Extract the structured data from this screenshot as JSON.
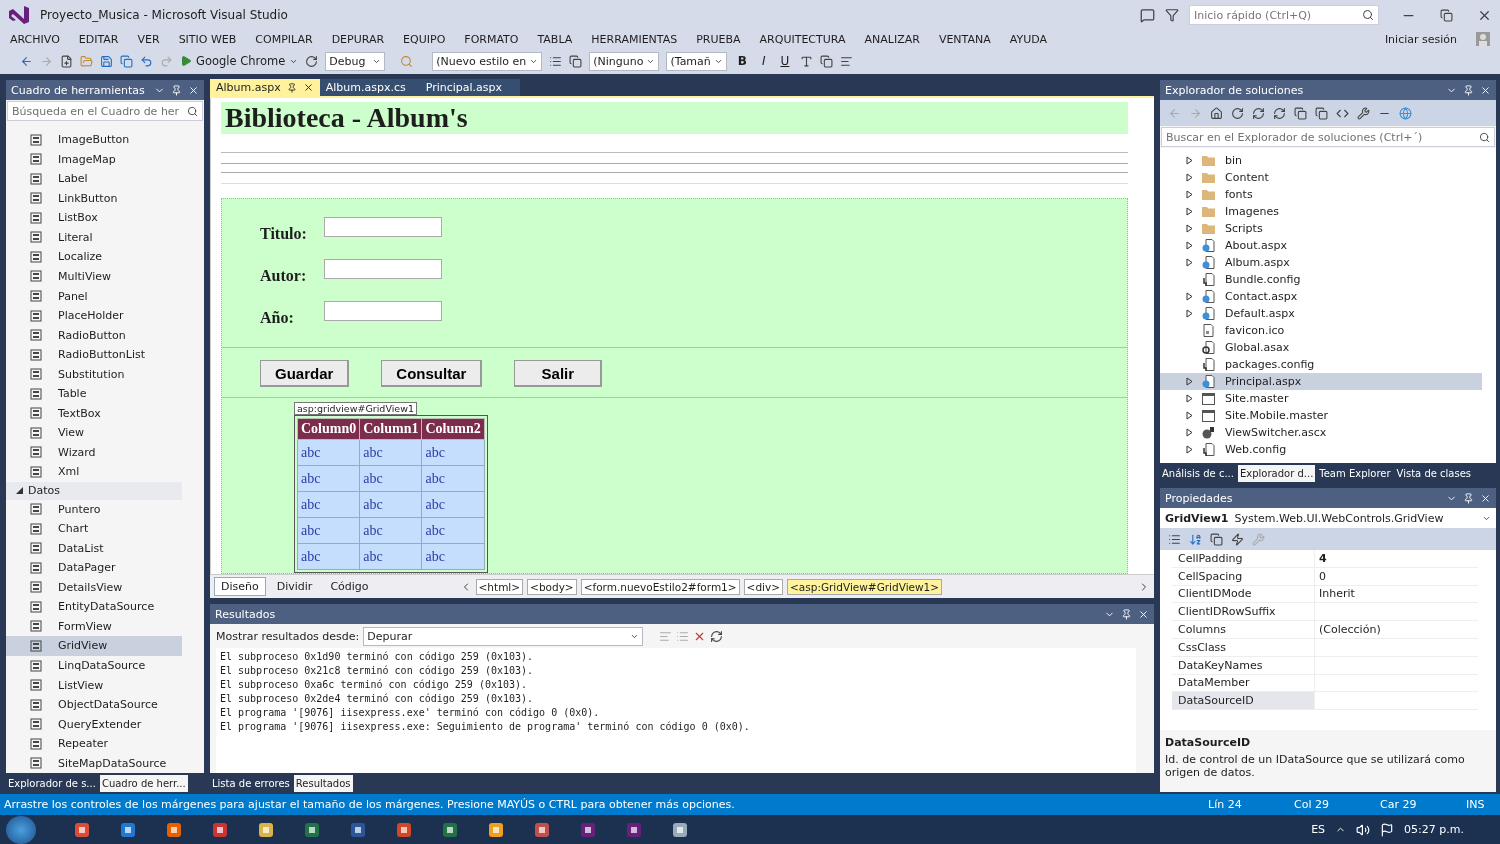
{
  "window": {
    "title": "Proyecto_Musica - Microsoft Visual Studio",
    "quick_launch_placeholder": "Inicio rápido (Ctrl+Q)",
    "sign_in": "Iniciar sesión"
  },
  "menu": [
    "ARCHIVO",
    "EDITAR",
    "VER",
    "SITIO WEB",
    "COMPILAR",
    "DEPURAR",
    "EQUIPO",
    "FORMATO",
    "TABLA",
    "HERRAMIENTAS",
    "PRUEBA",
    "ARQUITECTURA",
    "ANALIZAR",
    "VENTANA",
    "AYUDA"
  ],
  "toolbar": {
    "browser": "Google Chrome",
    "configuration": "Debug",
    "style": "(Nuevo estilo en",
    "font": "(Ninguno",
    "size": "(Tamañ",
    "bold": "B",
    "italic": "I",
    "underline": "U"
  },
  "toolbox": {
    "title": "Cuadro de herramientas",
    "search_placeholder": "Búsqueda en el Cuadro de her",
    "items": [
      {
        "label": "ImageButton",
        "selected": false
      },
      {
        "label": "ImageMap",
        "selected": false
      },
      {
        "label": "Label",
        "selected": false
      },
      {
        "label": "LinkButton",
        "selected": false
      },
      {
        "label": "ListBox",
        "selected": false
      },
      {
        "label": "Literal",
        "selected": false
      },
      {
        "label": "Localize",
        "selected": false
      },
      {
        "label": "MultiView",
        "selected": false
      },
      {
        "label": "Panel",
        "selected": false
      },
      {
        "label": "PlaceHolder",
        "selected": false
      },
      {
        "label": "RadioButton",
        "selected": false
      },
      {
        "label": "RadioButtonList",
        "selected": false
      },
      {
        "label": "Substitution",
        "selected": false
      },
      {
        "label": "Table",
        "selected": false
      },
      {
        "label": "TextBox",
        "selected": false
      },
      {
        "label": "View",
        "selected": false
      },
      {
        "label": "Wizard",
        "selected": false
      },
      {
        "label": "Xml",
        "selected": false
      }
    ],
    "group": {
      "label": "Datos",
      "expanded": true,
      "items": [
        {
          "label": "Puntero",
          "selected": false
        },
        {
          "label": "Chart",
          "selected": false
        },
        {
          "label": "DataList",
          "selected": false
        },
        {
          "label": "DataPager",
          "selected": false
        },
        {
          "label": "DetailsView",
          "selected": false
        },
        {
          "label": "EntityDataSource",
          "selected": false
        },
        {
          "label": "FormView",
          "selected": false
        },
        {
          "label": "GridView",
          "selected": true
        },
        {
          "label": "LinqDataSource",
          "selected": false
        },
        {
          "label": "ListView",
          "selected": false
        },
        {
          "label": "ObjectDataSource",
          "selected": false
        },
        {
          "label": "QueryExtender",
          "selected": false
        },
        {
          "label": "Repeater",
          "selected": false
        },
        {
          "label": "SiteMapDataSource",
          "selected": false
        }
      ]
    },
    "tabs": [
      {
        "label": "Explorador de s...",
        "selected": false
      },
      {
        "label": "Cuadro de herr...",
        "selected": true
      }
    ]
  },
  "editor": {
    "tabs": [
      {
        "label": "Album.aspx",
        "selected": true
      },
      {
        "label": "Album.aspx.cs",
        "selected": false
      },
      {
        "label": "Principal.aspx",
        "selected": false
      }
    ],
    "heading": "Biblioteca - Album's",
    "fields": [
      {
        "label": "Titulo:"
      },
      {
        "label": "Autor:"
      },
      {
        "label": "Año:"
      }
    ],
    "buttons": [
      "Guardar",
      "Consultar",
      "Salir"
    ],
    "grid": {
      "tag": "asp:gridview#GridView1",
      "columns": [
        "Column0",
        "Column1",
        "Column2"
      ],
      "rows": [
        [
          "abc",
          "abc",
          "abc"
        ],
        [
          "abc",
          "abc",
          "abc"
        ],
        [
          "abc",
          "abc",
          "abc"
        ],
        [
          "abc",
          "abc",
          "abc"
        ],
        [
          "abc",
          "abc",
          "abc"
        ]
      ]
    },
    "views": [
      {
        "label": "Diseño",
        "selected": true
      },
      {
        "label": "Dividir",
        "selected": false
      },
      {
        "label": "Código",
        "selected": false
      }
    ],
    "breadcrumbs": [
      {
        "label": "<html>",
        "selected": false
      },
      {
        "label": "<body>",
        "selected": false
      },
      {
        "label": "<form.nuevoEstilo2#form1>",
        "selected": false
      },
      {
        "label": "<div>",
        "selected": false
      },
      {
        "label": "<asp:GridView#GridView1>",
        "selected": true
      }
    ]
  },
  "output": {
    "title": "Resultados",
    "source_label": "Mostrar resultados desde:",
    "source": "Depurar",
    "lines": [
      "El subproceso 0x1d90 terminó con código 259 (0x103).",
      "El subproceso 0x21c8 terminó con código 259 (0x103).",
      "El subproceso 0xa6c terminó con código 259 (0x103).",
      "El subproceso 0x2de4 terminó con código 259 (0x103).",
      "El programa '[9076] iisexpress.exe' terminó con código 0 (0x0).",
      "El programa '[9076] iisexpress.exe: Seguimiento de programa' terminó con código 0 (0x0)."
    ],
    "tabs": [
      {
        "label": "Lista de errores",
        "selected": false
      },
      {
        "label": "Resultados",
        "selected": true
      }
    ]
  },
  "solution_explorer": {
    "title": "Explorador de soluciones",
    "search_placeholder": "Buscar en el Explorador de soluciones (Ctrl+´)",
    "items": [
      {
        "label": "bin",
        "kind": "folder",
        "expandable": true,
        "selected": false
      },
      {
        "label": "Content",
        "kind": "folder",
        "expandable": true,
        "selected": false
      },
      {
        "label": "fonts",
        "kind": "folder",
        "expandable": true,
        "selected": false
      },
      {
        "label": "Imagenes",
        "kind": "folder",
        "expandable": true,
        "selected": false
      },
      {
        "label": "Scripts",
        "kind": "folder",
        "expandable": true,
        "selected": false
      },
      {
        "label": "About.aspx",
        "kind": "page",
        "expandable": true,
        "selected": false
      },
      {
        "label": "Album.aspx",
        "kind": "page",
        "expandable": true,
        "selected": false
      },
      {
        "label": "Bundle.config",
        "kind": "config",
        "expandable": false,
        "selected": false
      },
      {
        "label": "Contact.aspx",
        "kind": "page",
        "expandable": true,
        "selected": false
      },
      {
        "label": "Default.aspx",
        "kind": "page",
        "expandable": true,
        "selected": false
      },
      {
        "label": "favicon.ico",
        "kind": "file",
        "expandable": false,
        "selected": false
      },
      {
        "label": "Global.asax",
        "kind": "global",
        "expandable": false,
        "selected": false
      },
      {
        "label": "packages.config",
        "kind": "config",
        "expandable": false,
        "selected": false
      },
      {
        "label": "Principal.aspx",
        "kind": "page",
        "expandable": true,
        "selected": true
      },
      {
        "label": "Site.master",
        "kind": "master",
        "expandable": true,
        "selected": false
      },
      {
        "label": "Site.Mobile.master",
        "kind": "master",
        "expandable": true,
        "selected": false
      },
      {
        "label": "ViewSwitcher.ascx",
        "kind": "control",
        "expandable": true,
        "selected": false
      },
      {
        "label": "Web.config",
        "kind": "config",
        "expandable": true,
        "selected": false
      }
    ],
    "tabs": [
      {
        "label": "Análisis de c...",
        "selected": false
      },
      {
        "label": "Explorador d...",
        "selected": true
      },
      {
        "label": "Team Explorer",
        "selected": false
      },
      {
        "label": "Vista de clases",
        "selected": false
      }
    ]
  },
  "properties": {
    "title": "Propiedades",
    "object": "GridView1",
    "type": "System.Web.UI.WebControls.GridView",
    "rows": [
      {
        "name": "CellPadding",
        "value": "4",
        "modified": true,
        "selected": false
      },
      {
        "name": "CellSpacing",
        "value": "0",
        "modified": false,
        "selected": false
      },
      {
        "name": "ClientIDMode",
        "value": "Inherit",
        "modified": false,
        "selected": false
      },
      {
        "name": "ClientIDRowSuffix",
        "selected": false
      },
      {
        "name": "Columns",
        "value": "(Colección)",
        "modified": false,
        "selected": false
      },
      {
        "name": "CssClass",
        "selected": false
      },
      {
        "name": "DataKeyNames",
        "selected": false
      },
      {
        "name": "DataMember",
        "selected": false
      },
      {
        "name": "DataSourceID",
        "selected": true
      }
    ],
    "description_title": "DataSourceID",
    "description": "Id. de control de un IDataSource que se utilizará como origen de datos."
  },
  "status_bar": {
    "message": "Arrastre los controles de los márgenes para ajustar el tamaño de los márgenes. Presione MAYÚS o CTRL para obtener más opciones.",
    "line": "Lín 24",
    "column": "Col 29",
    "character": "Car 29",
    "mode": "INS"
  },
  "taskbar": {
    "language": "ES",
    "time": "05:27 p.m."
  }
}
